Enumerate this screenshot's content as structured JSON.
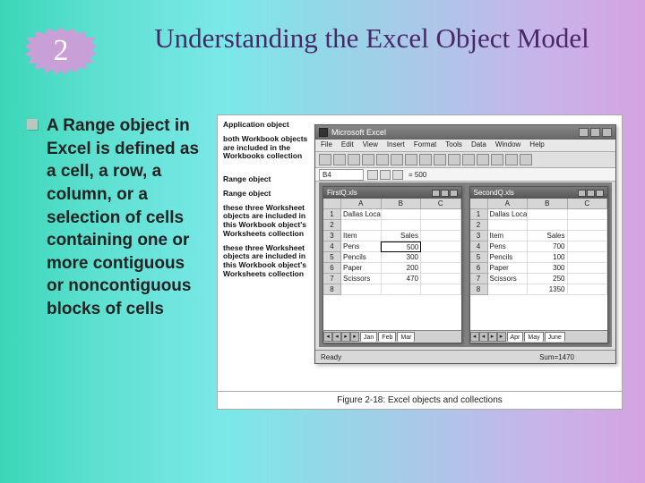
{
  "badge": {
    "number": "2"
  },
  "title": "Understanding the Excel Object Model",
  "body_text": "A Range object in Excel is defined as a cell, a row, a column, or a selection of cells containing one or more contiguous or noncontiguous blocks of cells",
  "annotations": {
    "a1": "Application object",
    "a2": "both Workbook objects are included in the Workbooks collection",
    "a3": "Range object",
    "a4": "Range object",
    "a5": "these three Worksheet objects are included in this Workbook object's Worksheets collection",
    "a6": "these three Worksheet objects are included in this Workbook object's Worksheets collection"
  },
  "excel": {
    "app_title": "Microsoft Excel",
    "menus": [
      "File",
      "Edit",
      "View",
      "Insert",
      "Format",
      "Tools",
      "Data",
      "Window",
      "Help"
    ],
    "namebox": "B4",
    "formula": "= 500",
    "status_left": "Ready",
    "status_sum": "Sum=1470",
    "wb1": {
      "title": "FirstQ.xls",
      "cols": [
        "A",
        "B",
        "C"
      ],
      "rows": [
        {
          "n": "1",
          "a": "Dallas Location",
          "b": "",
          "c": ""
        },
        {
          "n": "2",
          "a": "",
          "b": "",
          "c": ""
        },
        {
          "n": "3",
          "a": "Item",
          "b": "Sales",
          "c": ""
        },
        {
          "n": "4",
          "a": "Pens",
          "b": "500",
          "c": ""
        },
        {
          "n": "5",
          "a": "Pencils",
          "b": "300",
          "c": ""
        },
        {
          "n": "6",
          "a": "Paper",
          "b": "200",
          "c": ""
        },
        {
          "n": "7",
          "a": "Scissors",
          "b": "470",
          "c": ""
        },
        {
          "n": "8",
          "a": "",
          "b": "",
          "c": ""
        }
      ],
      "tabs": [
        "Jan",
        "Feb",
        "Mar"
      ]
    },
    "wb2": {
      "title": "SecondQ.xls",
      "cols": [
        "A",
        "B",
        "C"
      ],
      "rows": [
        {
          "n": "1",
          "a": "Dallas Location",
          "b": "",
          "c": ""
        },
        {
          "n": "2",
          "a": "",
          "b": "",
          "c": ""
        },
        {
          "n": "3",
          "a": "Item",
          "b": "Sales",
          "c": ""
        },
        {
          "n": "4",
          "a": "Pens",
          "b": "700",
          "c": ""
        },
        {
          "n": "5",
          "a": "Pencils",
          "b": "100",
          "c": ""
        },
        {
          "n": "6",
          "a": "Paper",
          "b": "300",
          "c": ""
        },
        {
          "n": "7",
          "a": "Scissors",
          "b": "250",
          "c": ""
        },
        {
          "n": "8",
          "a": "",
          "b": "1350",
          "c": ""
        }
      ],
      "tabs": [
        "Apr",
        "May",
        "June"
      ]
    }
  },
  "caption": "Figure 2-18: Excel objects and collections"
}
